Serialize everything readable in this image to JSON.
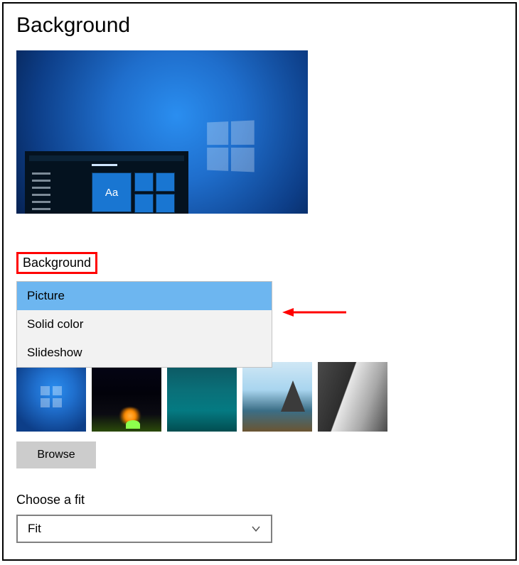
{
  "page_title": "Background",
  "preview": {
    "sample_text": "Aa"
  },
  "background_section": {
    "label": "Background",
    "options": [
      "Picture",
      "Solid color",
      "Slideshow"
    ],
    "selected": "Picture"
  },
  "thumbnails": [
    {
      "name": "windows-default"
    },
    {
      "name": "night-campfire"
    },
    {
      "name": "underwater"
    },
    {
      "name": "beach-rock"
    },
    {
      "name": "waterfall-rock"
    }
  ],
  "browse_label": "Browse",
  "fit_section": {
    "label": "Choose a fit",
    "value": "Fit"
  },
  "annotation": {
    "highlight_color": "#ff0000"
  }
}
